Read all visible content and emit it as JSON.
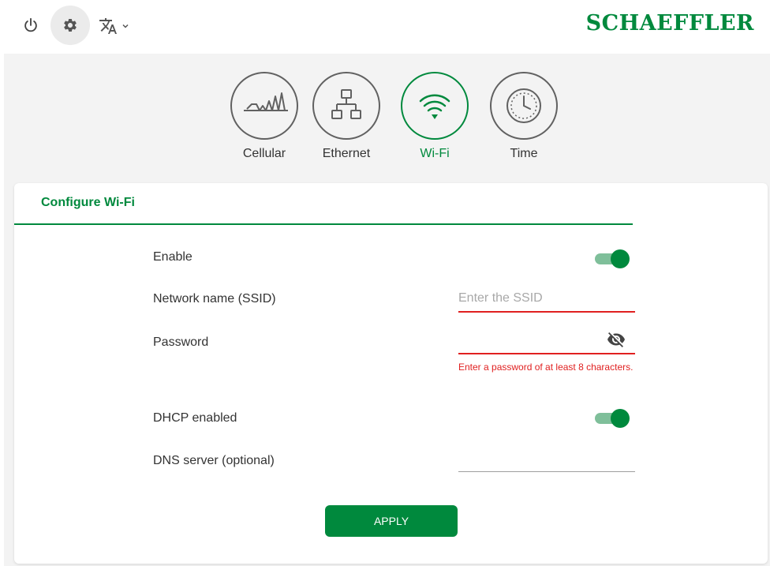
{
  "colors": {
    "accent": "#00893d",
    "accent_light": "#7fbf9a",
    "error": "#e02020",
    "icon_gray": "#616161",
    "brand": "#00893d"
  },
  "header": {
    "brand_text": "SCHAEFFLER",
    "power_icon": "power-icon",
    "settings_icon": "gear-icon",
    "language_icon": "translate-icon"
  },
  "stepper": {
    "steps": [
      {
        "label": "Cellular",
        "icon": "cellular-signal-icon",
        "active": false
      },
      {
        "label": "Ethernet",
        "icon": "ethernet-network-icon",
        "active": false
      },
      {
        "label": "Wi-Fi",
        "icon": "wifi-icon",
        "active": true
      },
      {
        "label": "Time",
        "icon": "clock-icon",
        "active": false
      }
    ]
  },
  "form": {
    "title": "Configure Wi-Fi",
    "enable": {
      "label": "Enable",
      "on": true
    },
    "ssid": {
      "label": "Network name (SSID)",
      "placeholder": "Enter the SSID",
      "value": ""
    },
    "password": {
      "label": "Password",
      "value": "",
      "error": "Enter a password of at least 8 characters.",
      "visibility_icon": "eye-off-icon"
    },
    "dhcp": {
      "label": "DHCP enabled",
      "on": true
    },
    "dns": {
      "label": "DNS server (optional)",
      "value": ""
    },
    "apply_label": "APPLY"
  }
}
